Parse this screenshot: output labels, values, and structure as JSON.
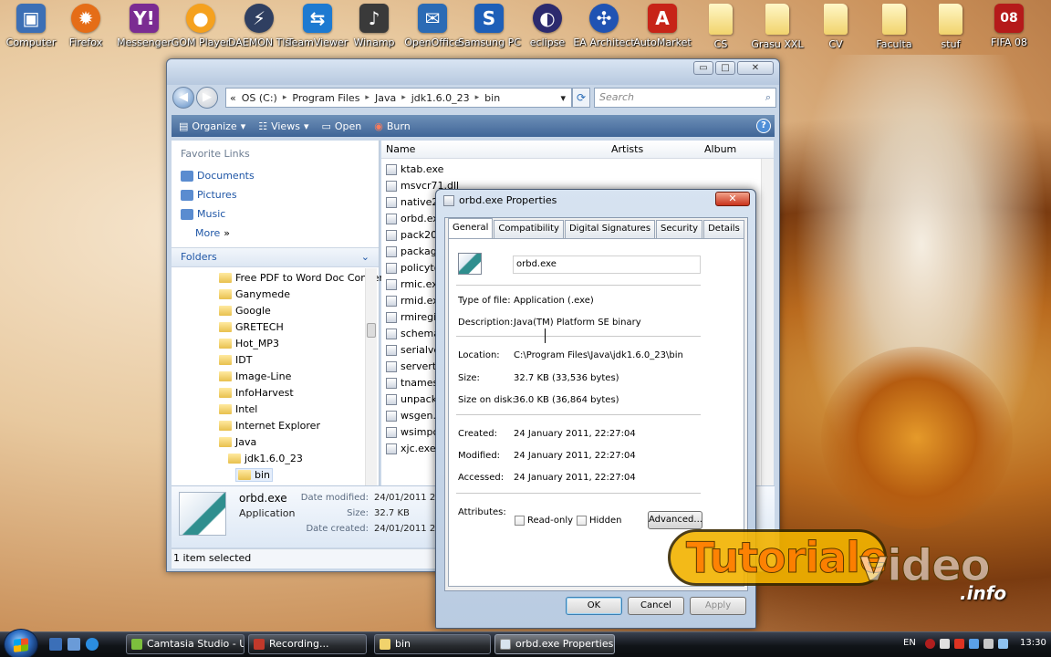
{
  "desktop": {
    "icons": [
      {
        "label": "Computer",
        "icon": "computer-icon"
      },
      {
        "label": "Firefox",
        "icon": "firefox-icon"
      },
      {
        "label": "Messenger",
        "icon": "messenger-icon"
      },
      {
        "label": "GOM Player",
        "icon": "gom-player-icon"
      },
      {
        "label": "DAEMON Tls",
        "icon": "daemon-tools-icon"
      },
      {
        "label": "TeamViewer",
        "icon": "teamviewer-icon"
      },
      {
        "label": "Winamp",
        "icon": "winamp-icon"
      },
      {
        "label": "OpenOffice",
        "icon": "openoffice-icon"
      },
      {
        "label": "Samsung PC",
        "icon": "samsung-pc-icon"
      },
      {
        "label": "eclipse",
        "icon": "eclipse-icon"
      },
      {
        "label": "EA Architect",
        "icon": "ea-architect-icon"
      },
      {
        "label": "AutoMarket",
        "icon": "automarket-icon"
      },
      {
        "label": "CS",
        "icon": "folder-icon"
      },
      {
        "label": "Grasu XXL",
        "icon": "folder-icon"
      },
      {
        "label": "CV",
        "icon": "folder-icon"
      },
      {
        "label": "Faculta",
        "icon": "folder-icon"
      },
      {
        "label": "stuf",
        "icon": "folder-icon"
      },
      {
        "label": "FIFA 08",
        "icon": "fifa-08-icon"
      }
    ],
    "watermark": {
      "word1": "Tutoriale",
      "word2": "video",
      "suffix": ".info"
    }
  },
  "explorer": {
    "caption_buttons": {
      "minimize": "▭",
      "maximize": "□",
      "close": "✕"
    },
    "nav": {
      "back": "◀",
      "forward": "▶"
    },
    "address": {
      "prefix": "«",
      "segments": [
        "OS (C:)",
        "Program Files",
        "Java",
        "jdk1.6.0_23",
        "bin"
      ],
      "separator": "▸",
      "dropdown": "▾"
    },
    "refresh_glyph": "⟳",
    "search_placeholder": "Search",
    "toolbar": {
      "organize": "Organize",
      "views": "Views",
      "open": "Open",
      "burn": "Burn",
      "help": "?"
    },
    "nav_pane": {
      "favorite_links_header": "Favorite Links",
      "favorites": [
        "Documents",
        "Pictures",
        "Music"
      ],
      "more": "More",
      "more_arrow": "»",
      "folders_header": "Folders",
      "folders_chevron": "⌄",
      "tree": [
        "Free PDF to Word Doc Converter",
        "Ganymede",
        "Google",
        "GRETECH",
        "Hot_MP3",
        "IDT",
        "Image-Line",
        "InfoHarvest",
        "Intel",
        "Internet Explorer",
        "Java",
        "jdk1.6.0_23",
        "bin"
      ]
    },
    "file_pane": {
      "columns": [
        "Name",
        "Artists",
        "Album"
      ],
      "files": [
        "ktab.exe",
        "msvcr71.dll",
        "native2a",
        "orbd.exe",
        "pack200",
        "package",
        "policyto",
        "rmic.exe",
        "rmid.exe",
        "rmiregis",
        "schemag",
        "serialver",
        "servertoc",
        "tnamese",
        "unpack2",
        "wsgen.e",
        "wsimpor",
        "xjc.exe"
      ]
    },
    "details": {
      "name": "orbd.exe",
      "kind": "Application",
      "date_modified_label": "Date modified:",
      "date_modified": "24/01/2011 22:27",
      "size_label": "Size:",
      "size": "32.7 KB",
      "date_created_label": "Date created:",
      "date_created": "24/01/2011 22:27"
    },
    "status": "1 item selected"
  },
  "properties": {
    "title": "orbd.exe Properties",
    "close_glyph": "✕",
    "tabs": [
      "General",
      "Compatibility",
      "Digital Signatures",
      "Security",
      "Details"
    ],
    "active_tab": "General",
    "file_name": "orbd.exe",
    "rows": {
      "type_label": "Type of file:",
      "type_value": "Application (.exe)",
      "description_label": "Description:",
      "description_value": "Java(TM) Platform SE binary",
      "location_label": "Location:",
      "location_value": "C:\\Program Files\\Java\\jdk1.6.0_23\\bin",
      "size_label": "Size:",
      "size_value": "32.7 KB (33,536 bytes)",
      "size_on_disk_label": "Size on disk:",
      "size_on_disk_value": "36.0 KB (36,864 bytes)",
      "created_label": "Created:",
      "created_value": "24 January 2011, 22:27:04",
      "modified_label": "Modified:",
      "modified_value": "24 January 2011, 22:27:04",
      "accessed_label": "Accessed:",
      "accessed_value": "24 January 2011, 22:27:04",
      "attributes_label": "Attributes:"
    },
    "readonly_label": "Read-only",
    "hidden_label": "Hidden",
    "advanced_label": "Advanced...",
    "ok_label": "OK",
    "cancel_label": "Cancel",
    "apply_label": "Apply"
  },
  "taskbar": {
    "buttons": [
      {
        "label": "Camtasia Studio - U..."
      },
      {
        "label": "Recording..."
      },
      {
        "label": "bin"
      },
      {
        "label": "orbd.exe Properties"
      }
    ],
    "language": "EN",
    "clock": "13:30"
  },
  "colors": {
    "accent": "#3f6597",
    "link": "#1f56a6",
    "close_red": "#c8321b"
  }
}
